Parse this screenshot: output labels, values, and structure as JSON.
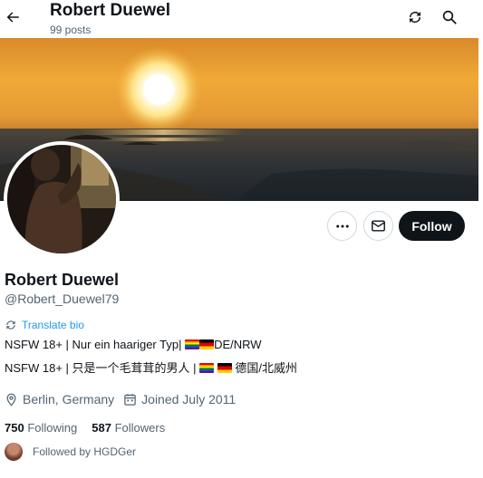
{
  "header": {
    "name": "Robert Duewel",
    "posts_count": "99 posts"
  },
  "icons": {
    "back": "back-arrow-icon",
    "translate": "translate-icon",
    "search": "search-icon",
    "more": "more-dots-icon",
    "message": "message-icon",
    "location": "location-pin-icon",
    "calendar": "calendar-icon"
  },
  "banner": {
    "description": "sunset over sea"
  },
  "actions": {
    "follow_label": "Follow"
  },
  "profile": {
    "display_name": "Robert Duewel",
    "handle": "@Robert_Duewel79",
    "translate_bio": "Translate bio",
    "bio_line1_prefix": "NSFW 18+ | Nur ein haariger Typ|",
    "bio_line1_suffix": "DE/NRW",
    "bio_line2_prefix": "NSFW 18+ | 只是一个毛茸茸的男人 |",
    "bio_line2_suffix": "德国/北威州",
    "location": "Berlin, Germany",
    "joined": "Joined July 2011"
  },
  "stats": {
    "following_count": "750",
    "following_label": "Following",
    "followers_count": "587",
    "followers_label": "Followers"
  },
  "followed_by": "Followed by HGDGer",
  "colors": {
    "accent": "#1d9bf0",
    "text": "#0f1419",
    "secondary": "#536471",
    "button_dark": "#0f1419",
    "border": "#cfd9de"
  }
}
